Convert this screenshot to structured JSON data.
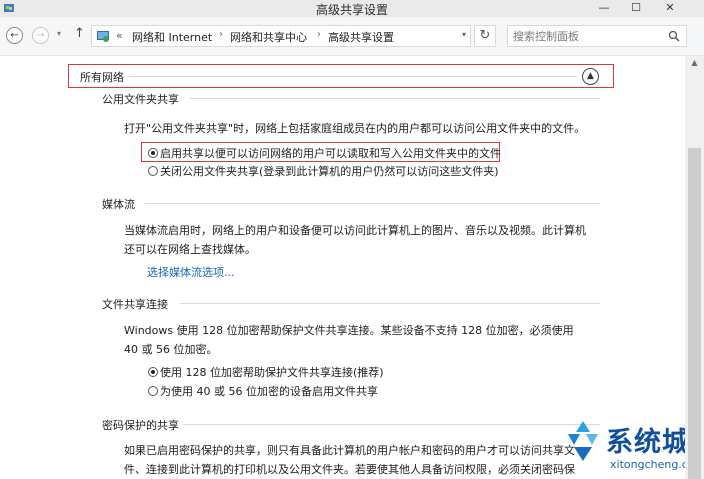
{
  "window": {
    "title": "高级共享设置"
  },
  "address_bar": {
    "lead": "«",
    "crumbs": [
      "网络和 Internet",
      "网络和共享中心",
      "高级共享设置"
    ],
    "separator": "›"
  },
  "search": {
    "placeholder": "搜索控制面板"
  },
  "network_group": {
    "title": "所有网络"
  },
  "sections": {
    "public_folder": {
      "title": "公用文件夹共享",
      "description": "打开\"公用文件夹共享\"时，网络上包括家庭组成员在内的用户都可以访问公用文件夹中的文件。",
      "options": [
        {
          "label": "启用共享以便可以访问网络的用户可以读取和写入公用文件夹中的文件",
          "selected": true
        },
        {
          "label": "关闭公用文件夹共享(登录到此计算机的用户仍然可以访问这些文件夹)",
          "selected": false
        }
      ]
    },
    "media_streaming": {
      "title": "媒体流",
      "description": "当媒体流启用时，网络上的用户和设备便可以访问此计算机上的图片、音乐以及视频。此计算机还可以在网络上查找媒体。",
      "link": "选择媒体流选项..."
    },
    "file_sharing": {
      "title": "文件共享连接",
      "description": "Windows 使用 128 位加密帮助保护文件共享连接。某些设备不支持 128 位加密，必须使用 40 或 56 位加密。",
      "options": [
        {
          "label": "使用 128 位加密帮助保护文件共享连接(推荐)",
          "selected": true
        },
        {
          "label": "为使用 40 或 56 位加密的设备启用文件共享",
          "selected": false
        }
      ]
    },
    "password_protected": {
      "title": "密码保护的共享",
      "description": "如果已启用密码保护的共享，则只有具备此计算机的用户帐户和密码的用户才可以访问共享文件、连接到此计算机的打印机以及公用文件夹。若要使其他人具备访问权限，必须关闭密码保护的共享。"
    }
  },
  "watermark": {
    "brand": "系统城",
    "url": "xitongcheng.com"
  },
  "colors": {
    "highlight_border": "#d73a3a",
    "link": "#1565c0",
    "watermark": "#0f4f9e"
  }
}
